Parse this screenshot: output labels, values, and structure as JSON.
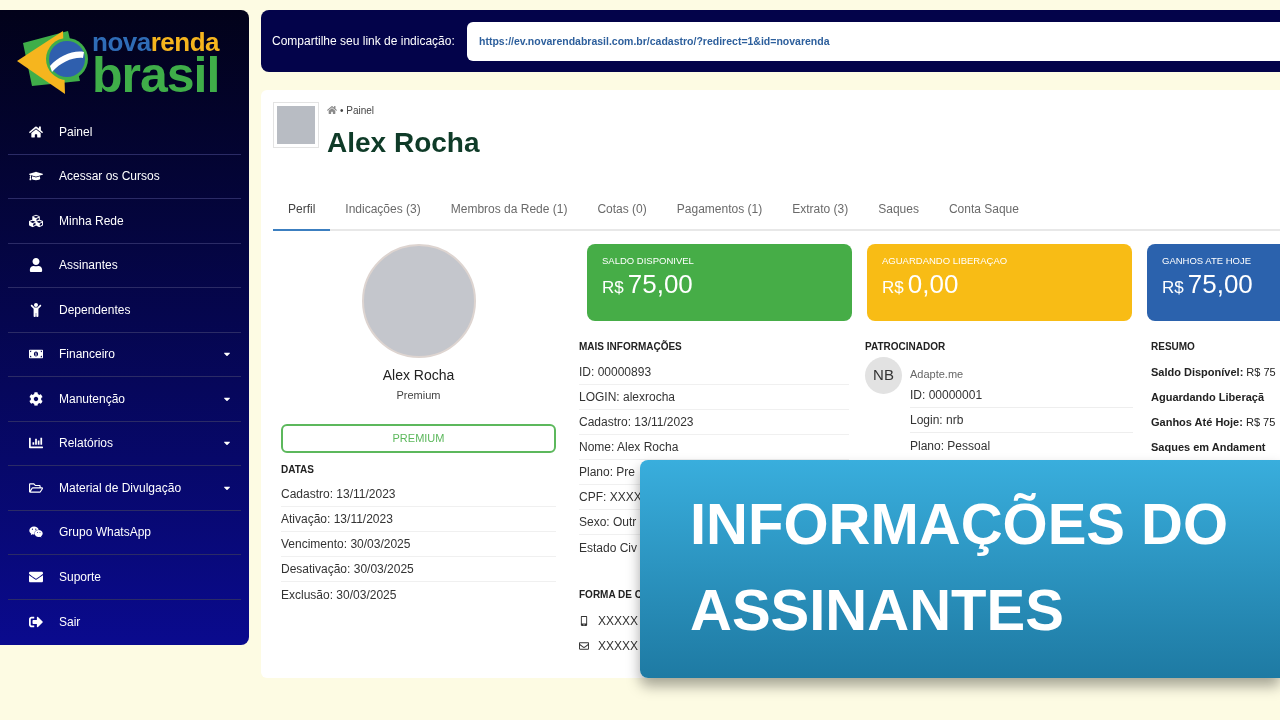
{
  "sidebar": {
    "logo": {
      "line_1": [
        "nova",
        "renda"
      ],
      "line_2": "brasil"
    },
    "items": [
      {
        "label": "Painel",
        "has_submenu": false
      },
      {
        "label": "Acessar os Cursos",
        "has_submenu": false
      },
      {
        "label": "Minha Rede",
        "has_submenu": false
      },
      {
        "label": "Assinantes",
        "has_submenu": false
      },
      {
        "label": "Dependentes",
        "has_submenu": false
      },
      {
        "label": "Financeiro",
        "has_submenu": true
      },
      {
        "label": "Manutenção",
        "has_submenu": true
      },
      {
        "label": "Relatórios",
        "has_submenu": true
      },
      {
        "label": "Material de Divulgação",
        "has_submenu": true
      },
      {
        "label": "Grupo WhatsApp",
        "has_submenu": false
      },
      {
        "label": "Suporte",
        "has_submenu": false
      },
      {
        "label": "Sair",
        "has_submenu": false
      }
    ]
  },
  "referral_bar": {
    "label": "Compartilhe seu link de indicação:",
    "link": "https://ev.novarendabrasil.com.br/cadastro/?redirect=1&id=novarenda"
  },
  "header": {
    "breadcrumb": "• Painel",
    "title": "Alex Rocha"
  },
  "tabs": [
    {
      "label": "Perfil",
      "selected": true
    },
    {
      "label": "Indicações (3)",
      "selected": false
    },
    {
      "label": "Membros da Rede (1)",
      "selected": false
    },
    {
      "label": "Cotas (0)",
      "selected": false
    },
    {
      "label": "Pagamentos (1)",
      "selected": false
    },
    {
      "label": "Extrato (3)",
      "selected": false
    },
    {
      "label": "Saques",
      "selected": false
    },
    {
      "label": "Conta Saque",
      "selected": false
    }
  ],
  "profile": {
    "name": "Alex Rocha",
    "plan": "Premium",
    "plan_button": "PREMIUM",
    "dates_heading": "DATAS",
    "dates": [
      "Cadastro: 13/11/2023",
      "Ativação: 13/11/2023",
      "Vencimento: 30/03/2025",
      "Desativação: 30/03/2025",
      "Exclusão: 30/03/2025"
    ]
  },
  "cards": [
    {
      "label": "SALDO DISPONIVEL",
      "currency": "R$",
      "amount": "75,00",
      "color": "#46ad47"
    },
    {
      "label": "AGUARDANDO LIBERAÇAO",
      "currency": "R$",
      "amount": "0,00",
      "color": "#f8bc15"
    },
    {
      "label": "GANHOS ATE HOJE",
      "currency": "R$",
      "amount": "75,00",
      "color": "#2b62ad"
    }
  ],
  "more_info": {
    "heading": "MAIS INFORMAÇÕES",
    "rows": [
      "ID: 00000893",
      "LOGIN: alexrocha",
      "Cadastro: 13/11/2023",
      "Nome: Alex Rocha",
      "Plano: Pre",
      "CPF: XXXX",
      "Sexo: Outr",
      "Estado Civ"
    ],
    "contact_heading": "FORMA DE C",
    "contacts": [
      {
        "kind": "phone",
        "value": "XXXXX"
      },
      {
        "kind": "email",
        "value": "XXXXX"
      }
    ]
  },
  "sponsor": {
    "heading": "PATROCINADOR",
    "initials": "NB",
    "name": "Adapte.me",
    "rows": [
      "ID: 00000001",
      "Login: nrb",
      "Plano: Pessoal"
    ]
  },
  "summary": {
    "heading": "RESUMO",
    "rows": [
      {
        "label": "Saldo Disponível:",
        "value": "R$ 75"
      },
      {
        "label": "Aguardando Liberaçã"
      },
      {
        "label": "Ganhos Até Hoje:",
        "value": "R$ 75"
      },
      {
        "label": "Saques em Andament"
      }
    ]
  },
  "overlay_title": "INFORMAÇÕES DO ASSINANTES"
}
